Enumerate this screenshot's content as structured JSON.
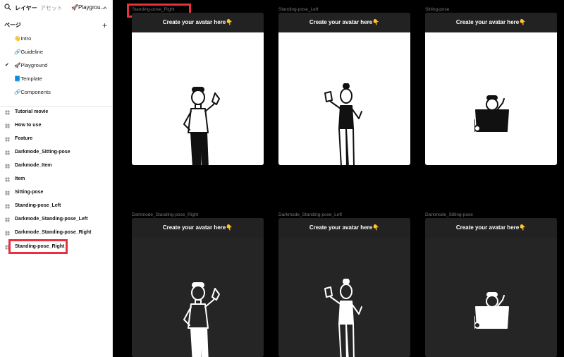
{
  "topbar": {
    "tab_layers": "レイヤー",
    "tab_assets": "アセット",
    "page_selector": "🚀Playgrou..."
  },
  "pages": {
    "title": "ページ",
    "items": [
      {
        "label": "👋Intro"
      },
      {
        "label": "🔗Guideline"
      },
      {
        "label": "🚀Playground",
        "selected": true
      },
      {
        "label": "📘Template"
      },
      {
        "label": "🔗Components"
      }
    ]
  },
  "layers": [
    "Tutorial movie",
    "How to use",
    "Feature",
    "Darkmode_Sitting-pose",
    "Darkmode_Item",
    "Item",
    "Sitting-pose",
    "Standing-pose_Left",
    "Darkmode_Standing-pose_Left",
    "Darkmode_Standing-pose_Right",
    "Standing-pose_Right"
  ],
  "frames": [
    {
      "name": "Standing-pose_Right",
      "header": "Create your avatar here👇"
    },
    {
      "name": "Standing-pose_Left",
      "header": "Create your avatar here👇"
    },
    {
      "name": "Sitting-pose",
      "header": "Create your avatar here👇"
    },
    {
      "name": "Darkmode_Standing-pose_Right",
      "header": "Create your avatar here👇"
    },
    {
      "name": "Darkmode_Standing-pose_Left",
      "header": "Create your avatar here👇"
    },
    {
      "name": "Darkmode_Sitting-pose",
      "header": "Create your avatar here👇"
    }
  ],
  "colors": {
    "highlight": "#e8313f",
    "canvas": "#000000",
    "frame_header": "#222222",
    "frame_dark_body": "#252525"
  }
}
